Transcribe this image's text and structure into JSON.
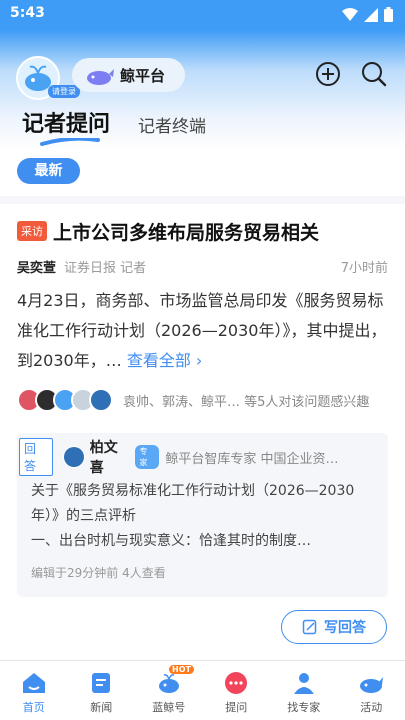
{
  "status": {
    "time": "5:43"
  },
  "header": {
    "login_badge": "请登录",
    "platform_label": "鲸平台"
  },
  "tabs": {
    "active": "记者提问",
    "other": "记者终端"
  },
  "feed": {
    "latest_label": "最新",
    "question": {
      "tag": "采访",
      "title": "上市公司多维布局服务贸易相关",
      "author": "吴奕萱",
      "author_meta": "证券日报 记者",
      "time": "7小时前",
      "body": "4月23日，商务部、市场监管总局印发《服务贸易标准化工作行动计划（2026—2030年）》，其中提出，到2030年，…",
      "view_all": "查看全部 ›",
      "followers_text": "袁帅、郭涛、鲸平… 等5人对该问题感兴趣"
    },
    "answer": {
      "tag": "回答",
      "name": "柏文喜",
      "badge": "专家",
      "title": "鲸平台智库专家 中国企业资…",
      "line1": "关于《服务贸易标准化工作行动计划（2026—2030年）》的三点评析",
      "line2": "一、出台时机与现实意义：恰逢其时的制度…",
      "meta": "编辑于29分钟前 4人查看"
    },
    "write_label": "写回答"
  },
  "nav": {
    "items": [
      {
        "label": "首页",
        "icon": "home-icon"
      },
      {
        "label": "新闻",
        "icon": "news-icon"
      },
      {
        "label": "蓝鲸号",
        "icon": "whale-icon"
      },
      {
        "label": "提问",
        "icon": "ask-icon"
      },
      {
        "label": "找专家",
        "icon": "expert-icon"
      },
      {
        "label": "活动",
        "icon": "activity-icon"
      }
    ],
    "hot_badge": "HOT"
  },
  "colors": {
    "accent": "#3f8ef0",
    "status_bar": "#3f9cf6",
    "tag_red": "#f25a3c",
    "ask_red": "#f2445b"
  }
}
